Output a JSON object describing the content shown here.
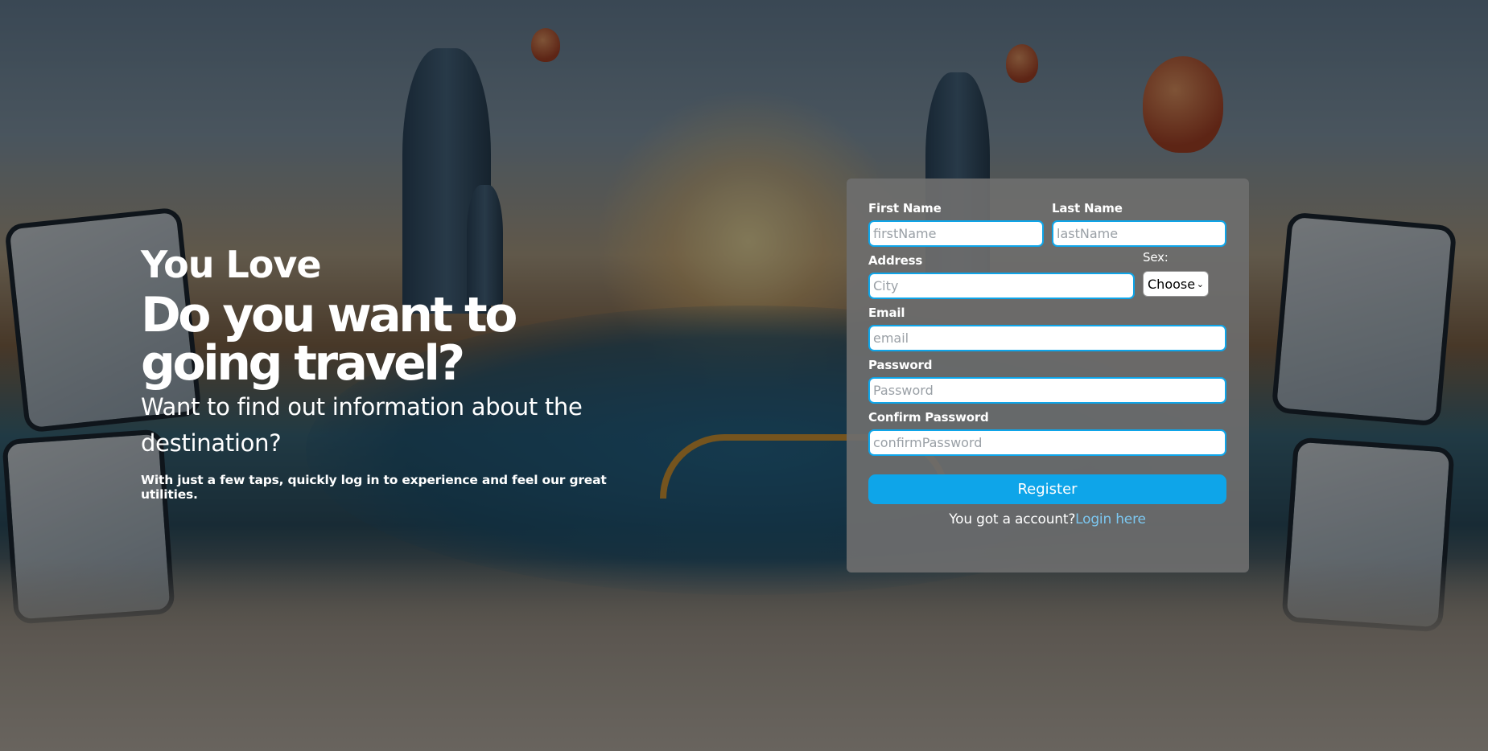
{
  "hero": {
    "eyebrow": "You Love",
    "title": "Do you want to going travel?",
    "subtitle": "Want to find out information about the destination?",
    "note": "With just a few taps, quickly log in to experience and feel our great utilities."
  },
  "form": {
    "first_name": {
      "label": "First Name",
      "placeholder": "firstName"
    },
    "last_name": {
      "label": "Last Name",
      "placeholder": "lastName"
    },
    "address": {
      "label": "Address",
      "placeholder": "City"
    },
    "sex": {
      "label": "Sex:",
      "selected": "Choose"
    },
    "email": {
      "label": "Email",
      "placeholder": "email"
    },
    "password": {
      "label": "Password",
      "placeholder": "Password"
    },
    "confirm_password": {
      "label": "Confirm Password",
      "placeholder": "confirmPassword"
    },
    "register_label": "Register",
    "login_prompt": "You got a account?",
    "login_link": "Login here"
  },
  "colors": {
    "accent": "#0ea5e9",
    "link": "#7cc7f0",
    "card": "#6e6e6e"
  }
}
